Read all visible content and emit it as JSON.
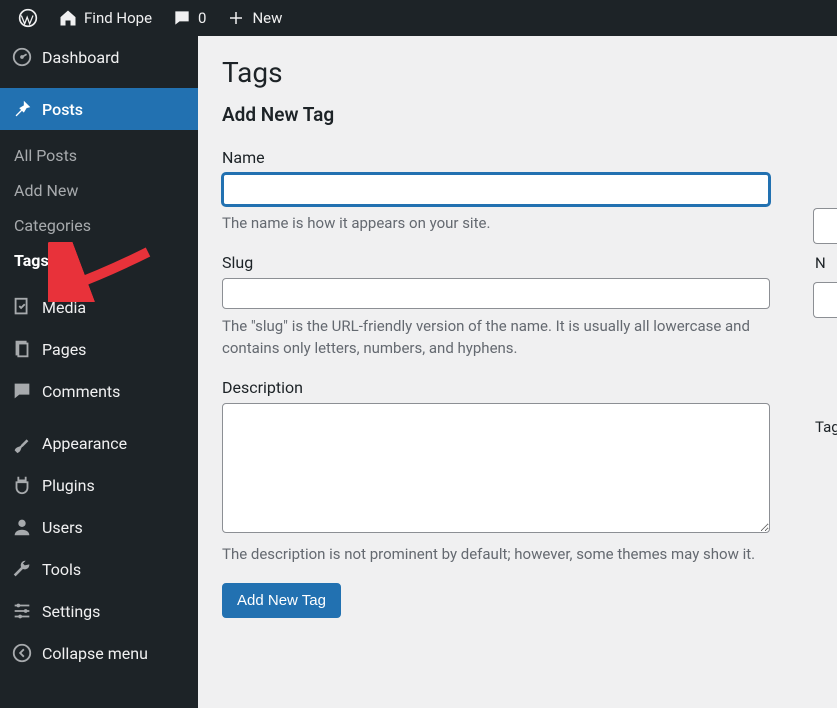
{
  "adminbar": {
    "site_name": "Find Hope",
    "comments_count": "0",
    "new_label": "New"
  },
  "sidebar": {
    "dashboard": "Dashboard",
    "posts": "Posts",
    "posts_submenu": {
      "all_posts": "All Posts",
      "add_new": "Add New",
      "categories": "Categories",
      "tags": "Tags"
    },
    "media": "Media",
    "pages": "Pages",
    "comments": "Comments",
    "appearance": "Appearance",
    "plugins": "Plugins",
    "users": "Users",
    "tools": "Tools",
    "settings": "Settings",
    "collapse": "Collapse menu"
  },
  "page": {
    "title": "Tags",
    "form_title": "Add New Tag",
    "name": {
      "label": "Name",
      "help": "The name is how it appears on your site."
    },
    "slug": {
      "label": "Slug",
      "help": "The \"slug\" is the URL-friendly version of the name. It is usually all lowercase and contains only letters, numbers, and hyphens."
    },
    "description": {
      "label": "Description",
      "help": "The description is not prominent by default; however, some themes may show it."
    },
    "submit_label": "Add New Tag"
  },
  "right": {
    "letter1": "N",
    "tag_label": "Tag"
  }
}
